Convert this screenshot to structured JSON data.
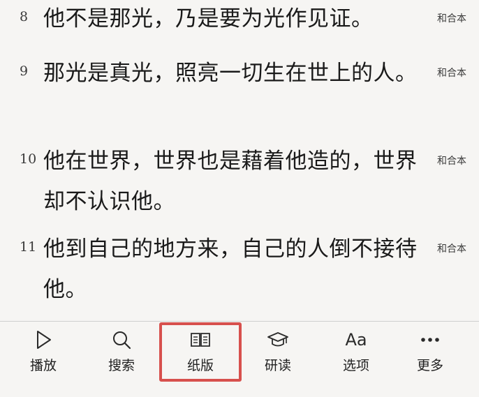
{
  "verses": [
    {
      "num": "8",
      "text": "他不是那光，乃是要为光作见证。",
      "version": "和合本"
    },
    {
      "num": "9",
      "text": "那光是真光，照亮一切生在世上的人。",
      "version": "和合本"
    },
    {
      "num": "10",
      "text": "他在世界，世界也是藉着他造的，世界却不认识他。",
      "version": "和合本"
    },
    {
      "num": "11",
      "text": "他到自己的地方来，自己的人倒不接待他。",
      "version": "和合本"
    }
  ],
  "toolbar": {
    "items": [
      {
        "label": "播放",
        "icon": "play-icon"
      },
      {
        "label": "搜索",
        "icon": "search-icon"
      },
      {
        "label": "纸版",
        "icon": "open-book-icon"
      },
      {
        "label": "研读",
        "icon": "graduation-cap-icon"
      },
      {
        "label": "选项",
        "icon": "text-size-icon",
        "glyph": "Aa"
      },
      {
        "label": "更多",
        "icon": "more-dots-icon"
      }
    ],
    "selected": "纸版",
    "highlight_color": "#d7504d"
  }
}
